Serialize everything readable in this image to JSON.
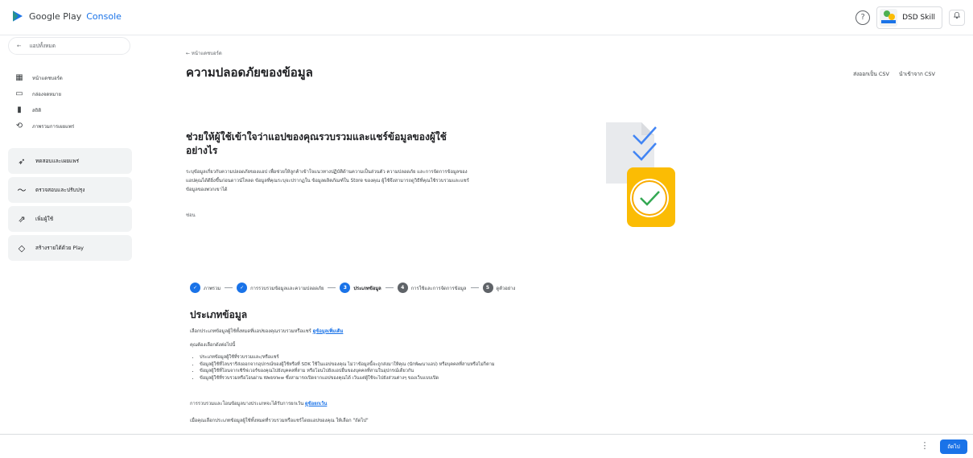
{
  "app": {
    "brand": "Google Play",
    "product": "Console"
  },
  "header": {
    "help_icon": "?",
    "account_name": "DSD Skill",
    "notif_icon": "bell-icon"
  },
  "sidebar": {
    "back_label": "แอปทั้งหมด",
    "items": [
      {
        "label": "หน้าแดชบอร์ด",
        "icon": "dashboard-icon"
      },
      {
        "label": "กล่องจดหมาย",
        "icon": "inbox-icon"
      },
      {
        "label": "สถิติ",
        "icon": "stats-icon"
      },
      {
        "label": "ภาพรวมการเผยแพร่",
        "icon": "publishing-icon"
      }
    ],
    "groups": [
      {
        "label": "ทดสอบและเผยแพร่",
        "icon": "rocket-icon"
      },
      {
        "label": "ตรวจสอบและปรับปรุง",
        "icon": "pulse-icon"
      },
      {
        "label": "เพิ่มผู้ใช้",
        "icon": "grow-icon"
      },
      {
        "label": "สร้างรายได้ด้วย Play",
        "icon": "tag-icon"
      }
    ]
  },
  "main": {
    "breadcrumb": "← หน้าแดชบอร์ด",
    "title": "ความปลอดภัยของข้อมูล",
    "export_csv": "ส่งออกเป็น CSV",
    "import_csv": "นำเข้าจาก CSV",
    "hero_title": "ช่วยให้ผู้ใช้เข้าใจว่าแอปของคุณรวบรวมและแชร์ข้อมูลของผู้ใช้อย่างไร",
    "hero_text": "ระบุข้อมูลเกี่ยวกับความปลอดภัยของแอป เพื่อช่วยให้ลูกค้าเข้าใจแนวทางปฏิบัติด้านความเป็นส่วนตัว ความปลอดภัย และการจัดการข้อมูลของแอปคุณได้ดียิ่งขึ้นก่อนดาวน์โหลด ข้อมูลที่คุณระบุจะปรากฏใน ข้อมูลผลิตภัณฑ์ใน Store ของคุณ ผู้ใช้จึงสามารถดูวิธีที่คุณใช้รวบรวมและแชร์ข้อมูลของพวกเขาได้",
    "hide_label": "ซ่อน",
    "steps": [
      {
        "n": "✓",
        "label": "ภาพรวม",
        "state": "done"
      },
      {
        "n": "✓",
        "label": "การรวบรวมข้อมูลและความปลอดภัย",
        "state": "done"
      },
      {
        "n": "3",
        "label": "ประเภทข้อมูล",
        "state": "current"
      },
      {
        "n": "4",
        "label": "การใช้และการจัดการข้อมูล",
        "state": "next"
      },
      {
        "n": "5",
        "label": "ดูตัวอย่าง",
        "state": "next"
      }
    ],
    "section_title": "ประเภทข้อมูล",
    "section_desc": "เลือกประเภทข้อมูลผู้ใช้ทั้งหมดที่แอปของคุณรวบรวมหรือแชร์",
    "learn_more": "ดูข้อมูลเพิ่มเติม",
    "need_label": "คุณต้องเลือกดังต่อไปนี้",
    "bullets": [
      "ประเภทข้อมูลผู้ใช้ที่รวบรวมและ/หรือแชร์",
      "ข้อมูลผู้ใช้ที่ไลบรารีส่งออกจากอุปกรณ์ของผู้ใช้หรือที่ SDK ใช้ในแอปของคุณ ไม่ว่าข้อมูลนี้จะถูกส่งมาให้คุณ (นักพัฒนาแอป) หรือบุคคลที่สามหรือไม่ก็ตาม",
      "ข้อมูลผู้ใช้ที่โอนจากเซิร์ฟเวอร์ของคุณไปยังบุคคลที่สาม หรือโอนไปยังแอปอื่นของบุคคลที่สามในอุปกรณ์เดียวกัน",
      "ข้อมูลผู้ใช้ที่รวบรวมหรือโอนผ่าน WebView ซึ่งสามารถเปิดจากแอปของคุณได้ เว้นแต่ผู้ใช้จะไปยังส่วนต่างๆ ของเว็บแบบเปิด"
    ],
    "exception_text": "การรวบรวมและโอนข้อมูลบางประเภทจะได้รับการยกเว้น",
    "exception_link": "ดูข้อยกเว้น",
    "final_text": "เมื่อคุณเลือกประเภทข้อมูลผู้ใช้ทั้งหมดที่รวบรวมหรือแชร์โดยแอปของคุณ ให้เลือก \"ถัดไป\""
  },
  "footer": {
    "more_icon": "⋮",
    "next_label": "ถัดไป"
  },
  "colors": {
    "accent": "#1a73e8",
    "illus_yellow": "#fbbc04"
  }
}
